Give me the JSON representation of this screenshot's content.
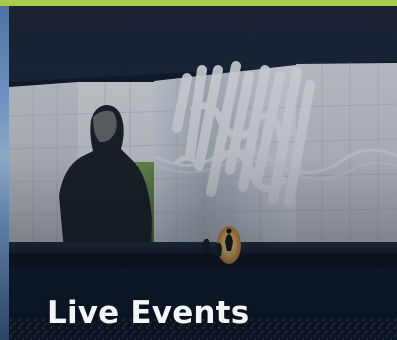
{
  "card": {
    "title": "Live Events"
  },
  "hero": {
    "image": "concert-stage-image"
  },
  "colors": {
    "accent": "#a7cc4a",
    "title": "#f3f5f7",
    "overlay": "#0f1a2a"
  }
}
